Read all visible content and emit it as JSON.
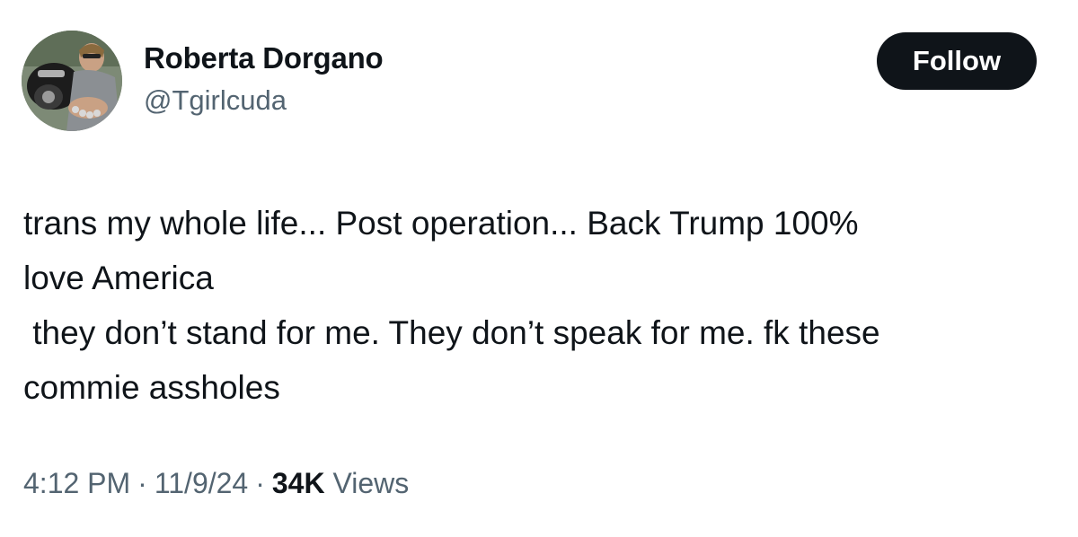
{
  "author": {
    "name": "Roberta Dorgano",
    "handle": "@Tgirlcuda"
  },
  "follow_button": {
    "label": "Follow"
  },
  "tweet": {
    "lines": [
      "trans my whole life... Post operation... Back Trump 100%",
      "love America",
      " they don’t stand for me. They don’t speak for me. fk these",
      "commie assholes"
    ]
  },
  "meta": {
    "time": "4:12 PM",
    "separator": "·",
    "date": "11/9/24",
    "views_count": "34K",
    "views_label": "Views"
  },
  "colors": {
    "text": "#0f1419",
    "secondary": "#536471",
    "button_bg": "#0f1419",
    "button_text": "#ffffff"
  }
}
